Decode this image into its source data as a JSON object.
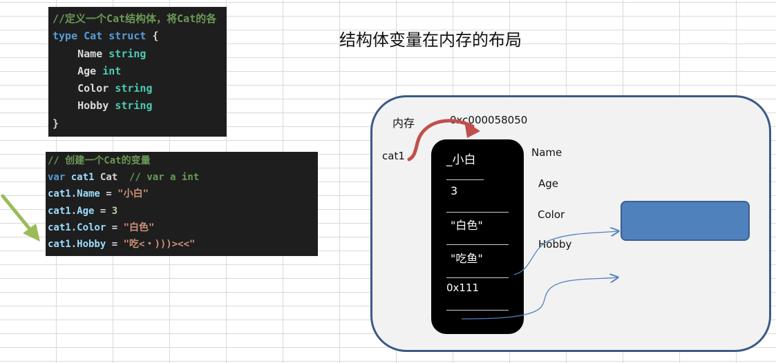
{
  "title": "结构体变量在内存的布局",
  "struct_code": {
    "comment": "//定义一个Cat结构体，将Cat的各",
    "line_type_kw": "type",
    "line_type_name": "Cat",
    "line_type_struct": "struct",
    "open_brace": "{",
    "fields": [
      {
        "name": "Name",
        "type": "string"
      },
      {
        "name": "Age",
        "type": "int"
      },
      {
        "name": "Color",
        "type": "string"
      },
      {
        "name": "Hobby",
        "type": "string"
      }
    ],
    "close_brace": "}"
  },
  "var_code": {
    "comment": "// 创建一个Cat的变量",
    "decl_kw": "var",
    "decl_name": "cat1",
    "decl_type": "Cat",
    "decl_comment": "// var a int",
    "assignments": [
      {
        "lhs": "cat1.Name",
        "eq": " = ",
        "rhs": "\"小白\""
      },
      {
        "lhs": "cat1.Age",
        "eq": " = ",
        "rhs": "3"
      },
      {
        "lhs": "cat1.Color",
        "eq": " = ",
        "rhs": "\"白色\""
      },
      {
        "lhs": "cat1.Hobby",
        "eq": " = ",
        "rhs": "\"吃<・)))><<\""
      }
    ]
  },
  "memory": {
    "label": "内存",
    "address": "0xc000058050",
    "var_label": "cat1",
    "values": [
      "_小白",
      "3",
      "\"白色\"",
      "\"吃鱼\"",
      "0x111"
    ],
    "field_labels": [
      "Name",
      "Age",
      "Color",
      "Hobby"
    ]
  },
  "colors": {
    "panel_border": "#3a5a86",
    "panel_fill": "#f2f2f2",
    "pointer_arrow": "#c0504d",
    "blue_rect": "#4f81bd",
    "green_arrow": "#9bbb59",
    "link_arrow": "#4f81bd"
  }
}
